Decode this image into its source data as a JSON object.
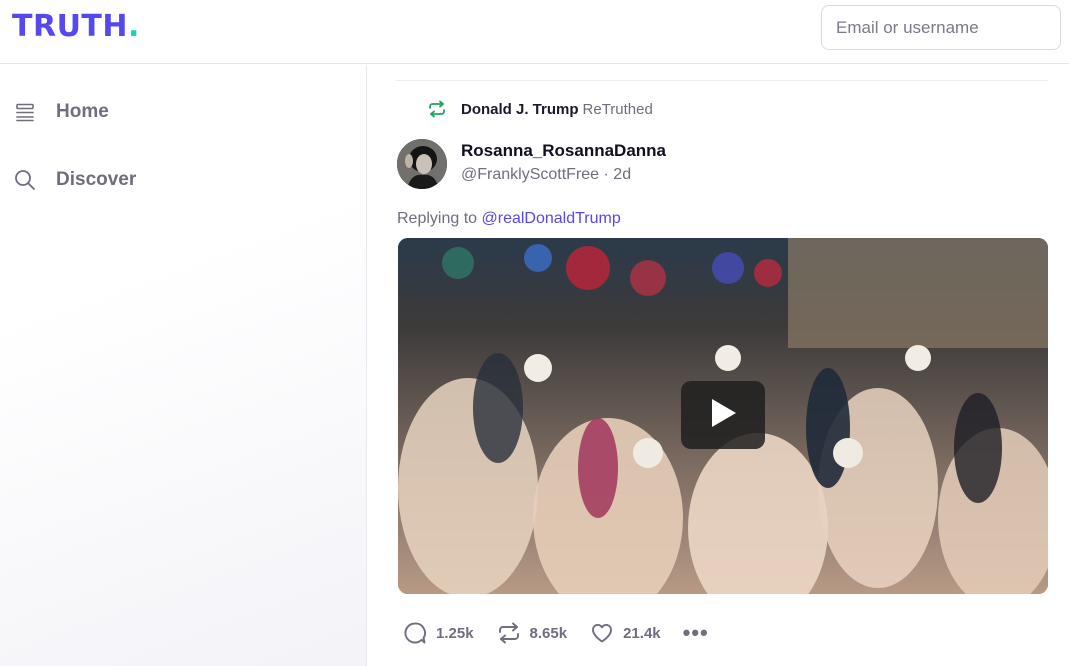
{
  "brand": {
    "logo_text": "TRUTH",
    "logo_dot": ".",
    "brand_color": "#5448ee",
    "accent_color": "#1bd1c1"
  },
  "header": {
    "login_placeholder": "Email or username"
  },
  "sidebar": {
    "items": [
      {
        "label": "Home",
        "icon": "home-list-icon"
      },
      {
        "label": "Discover",
        "icon": "search-icon"
      }
    ]
  },
  "post": {
    "retruth": {
      "user": "Donald J. Trump",
      "text": "ReTruthed",
      "icon": "retruth-icon",
      "color": "#1fa35f"
    },
    "author": {
      "display_name": "Rosanna_RosannaDanna",
      "handle": "@FranklyScottFree",
      "separator": "·",
      "age": "2d"
    },
    "replying": {
      "prefix": "Replying to",
      "mention": "@realDonaldTrump"
    },
    "media": {
      "type": "video",
      "play_icon": "play-icon"
    },
    "actions": {
      "replies": "1.25k",
      "retruths": "8.65k",
      "likes": "21.4k",
      "more": "•••"
    }
  }
}
